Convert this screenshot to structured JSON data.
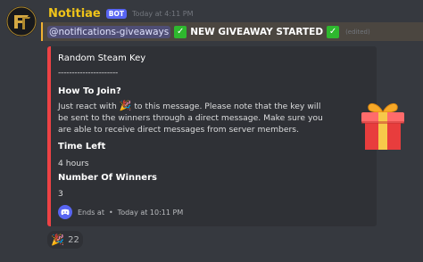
{
  "message": {
    "author": "Notitiae",
    "bot_tag": "BOT",
    "timestamp": "Today at 4:11 PM",
    "mention": "@notifications-giveaways",
    "announcement": "NEW GIVEAWAY STARTED",
    "edited": "(edited)",
    "check_icon": "white-check-mark-icon"
  },
  "embed": {
    "accent_color": "#ed4245",
    "title": "Random Steam Key",
    "divider": "----------------------",
    "field1_name": "How To Join?",
    "desc_part1": "Just react with",
    "desc_part2": " to this message. Please note that the key will be sent to the winners through a direct message. Make sure you are able to receive direct messages from server members.",
    "party_emoji": "🎉",
    "field2_name": "Time Left",
    "field2_value": "4 hours",
    "field3_name": "Number Of Winners",
    "field3_value": "3",
    "footer_ends": "Ends at",
    "footer_dot": "•",
    "footer_time": "Today at 10:11 PM",
    "thumbnail_icon": "gift-icon"
  },
  "reaction": {
    "emoji": "🎉",
    "count": "22"
  }
}
